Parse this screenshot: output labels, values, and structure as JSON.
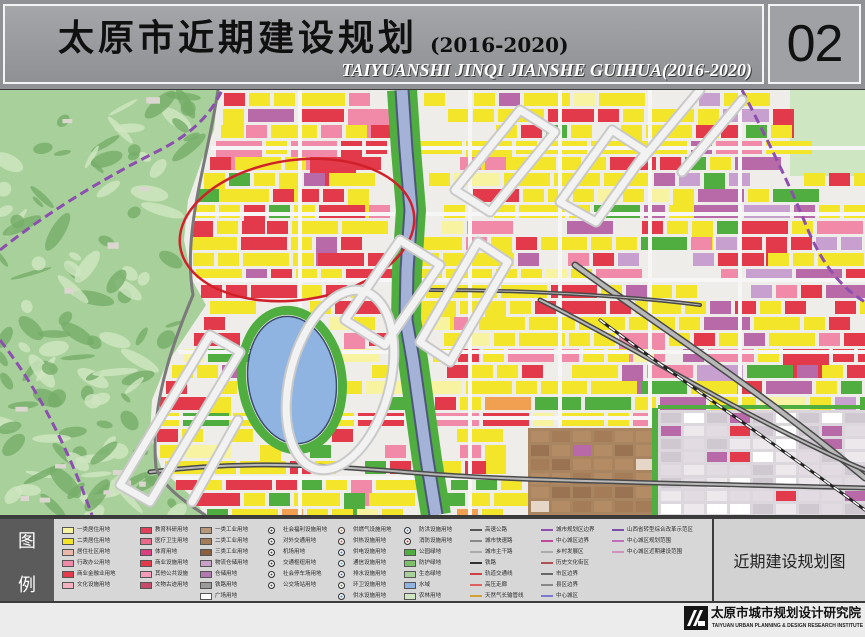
{
  "header": {
    "title": "太原市近期建设规划",
    "years": "(2016-2020)",
    "title_en": "TAIYUANSHI JINQI JIANSHE GUIHUA(2016-2020)",
    "sheet_number": "02"
  },
  "legend": {
    "heading_1": "图",
    "heading_2": "例",
    "map_name": "近期建设规划图",
    "columns": [
      [
        {
          "label": "一类居住用地",
          "color": "#f7f3a0",
          "kind": "fill"
        },
        {
          "label": "二类居住用地",
          "color": "#f2e52a",
          "kind": "fill"
        },
        {
          "label": "居住社区用地",
          "color": "#e9b8a8",
          "kind": "fill"
        },
        {
          "label": "行政办公用地",
          "color": "#f08aa8",
          "kind": "fill"
        },
        {
          "label": "商业金融业用地",
          "color": "#e23a4a",
          "kind": "fill"
        },
        {
          "label": "文化设施用地",
          "color": "#f3b0c0",
          "kind": "fill"
        }
      ],
      [
        {
          "label": "教育科研用地",
          "color": "#e2405a",
          "kind": "fill"
        },
        {
          "label": "医疗卫生用地",
          "color": "#e86a8a",
          "kind": "fill"
        },
        {
          "label": "体育用地",
          "color": "#d94080",
          "kind": "fill"
        },
        {
          "label": "商业设施用地",
          "color": "#e23a4a",
          "kind": "fill"
        },
        {
          "label": "其他公共设施",
          "color": "#f29cb8",
          "kind": "fill"
        },
        {
          "label": "文物古迹用地",
          "color": "#c84a6a",
          "kind": "fill"
        }
      ],
      [
        {
          "label": "一类工业用地",
          "color": "#b8987a",
          "kind": "fill"
        },
        {
          "label": "二类工业用地",
          "color": "#a47c5a",
          "kind": "fill"
        },
        {
          "label": "三类工业用地",
          "color": "#8a6040",
          "kind": "fill"
        },
        {
          "label": "物流仓储用地",
          "color": "#c9a0c8",
          "kind": "fill"
        },
        {
          "label": "仓储用地",
          "color": "#b07ab0",
          "kind": "fill"
        },
        {
          "label": "铁路用地",
          "color": "#9a9a9a",
          "kind": "fill"
        },
        {
          "label": "广场用地",
          "color": "#ffffff",
          "kind": "fill"
        }
      ],
      [
        {
          "label": "社会福利设施用地",
          "color": "#333333",
          "kind": "icon"
        },
        {
          "label": "对外交通用地",
          "color": "#555555",
          "kind": "icon"
        },
        {
          "label": "机场用地",
          "color": "#444444",
          "kind": "icon"
        },
        {
          "label": "交通枢纽用地",
          "color": "#3a3a3a",
          "kind": "icon"
        },
        {
          "label": "社会停车场用地",
          "color": "#4a4a4a",
          "kind": "icon"
        },
        {
          "label": "公交场站用地",
          "color": "#505050",
          "kind": "icon"
        }
      ],
      [
        {
          "label": "供燃气设施用地",
          "color": "#e07a30",
          "kind": "icon"
        },
        {
          "label": "供热设施用地",
          "color": "#d04a3a",
          "kind": "icon"
        },
        {
          "label": "供电设施用地",
          "color": "#3a7ad0",
          "kind": "icon"
        },
        {
          "label": "通信设施用地",
          "color": "#3aa0c0",
          "kind": "icon"
        },
        {
          "label": "排水设施用地",
          "color": "#4a6ab0",
          "kind": "icon"
        },
        {
          "label": "环卫设施用地",
          "color": "#6a8a4a",
          "kind": "icon"
        },
        {
          "label": "供水设施用地",
          "color": "#2a8ad0",
          "kind": "icon"
        }
      ],
      [
        {
          "label": "防洪设施用地",
          "color": "#4a7ab8",
          "kind": "icon"
        },
        {
          "label": "消防设施用地",
          "color": "#c03030",
          "kind": "icon"
        },
        {
          "label": "公园绿地",
          "color": "#4fae3f",
          "kind": "fill"
        },
        {
          "label": "防护绿地",
          "color": "#7cc06a",
          "kind": "fill"
        },
        {
          "label": "生态绿地",
          "color": "#a8d09a",
          "kind": "fill"
        },
        {
          "label": "水域",
          "color": "#8fb4e2",
          "kind": "fill"
        },
        {
          "label": "农林用地",
          "color": "#cfe6c2",
          "kind": "fill"
        }
      ],
      [
        {
          "label": "高速公路",
          "color": "#555555",
          "kind": "line"
        },
        {
          "label": "城市快速路",
          "color": "#888888",
          "kind": "line"
        },
        {
          "label": "城市主干路",
          "color": "#aaaaaa",
          "kind": "line"
        },
        {
          "label": "铁路",
          "color": "#333333",
          "kind": "dash"
        },
        {
          "label": "轨道交通线",
          "color": "#d04040",
          "kind": "line"
        },
        {
          "label": "高压走廊",
          "color": "#e06060",
          "kind": "dash"
        },
        {
          "label": "天然气长输管线",
          "color": "#d0a030",
          "kind": "dash"
        }
      ],
      [
        {
          "label": "城市规划区边界",
          "color": "#8c4fb0",
          "kind": "dash"
        },
        {
          "label": "中心城区边界",
          "color": "#c04a9a",
          "kind": "dash"
        },
        {
          "label": "乡村发展区",
          "color": "#aaaaaa",
          "kind": "dash"
        },
        {
          "label": "历史文化街区",
          "color": "#b05050",
          "kind": "dash"
        },
        {
          "label": "市区边界",
          "color": "#666666",
          "kind": "dash"
        },
        {
          "label": "县区边界",
          "color": "#888888",
          "kind": "dash"
        },
        {
          "label": "中心城区",
          "color": "#7a7ad0",
          "kind": "dash"
        }
      ],
      [
        {
          "label": "山西省转型综合改革示范区",
          "color": "#7a4fa8",
          "kind": "dash"
        },
        {
          "label": "中心城区规划范围",
          "color": "#c070b8",
          "kind": "dash"
        },
        {
          "label": "中心城区近期建设范围",
          "color": "#d090c0",
          "kind": "dash"
        }
      ]
    ]
  },
  "map": {
    "palette": {
      "background": "#efedea",
      "hill": "#a8d09a",
      "hill_dark": "#74ad68",
      "hill_light": "#cfe6c2",
      "residential": "#f2e52a",
      "residential_light": "#f7f3a0",
      "commercial": "#e23a4a",
      "public": "#f08aa8",
      "industrial": "#b86aa8",
      "logistics": "#c8a0d0",
      "green": "#4fae3f",
      "orange": "#f0a050",
      "water": "#8fb4e2",
      "river": "#a3b2d6",
      "hightech_zone": "#a98460",
      "grid_zone": "#dcd7dc",
      "boundary": "#8c4fb0",
      "recent_area_outline": "#d0202a",
      "watermark": "#f2f2f2"
    }
  },
  "footer": {
    "org_name": "太原市城市规划设计研究院",
    "org_name_en": "TAIYUAN URBAN PLANNING & DESIGN RESEARCH INSTITUTE"
  }
}
